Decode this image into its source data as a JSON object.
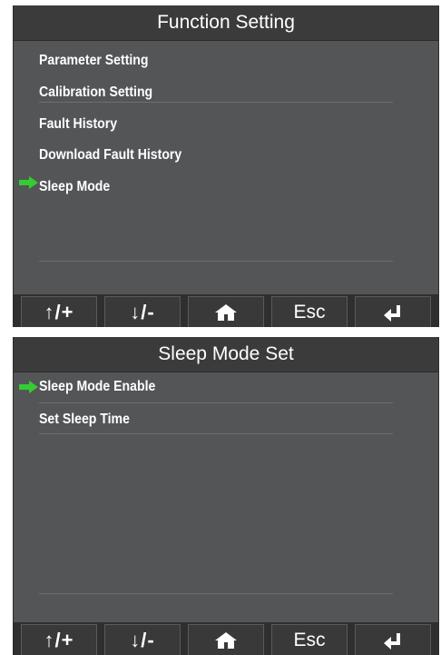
{
  "screen1": {
    "title": "Function Setting",
    "items": [
      {
        "label": "Parameter Setting"
      },
      {
        "label": "Calibration Setting"
      },
      {
        "label": "Fault History"
      },
      {
        "label": "Download Fault History"
      },
      {
        "label": "Sleep Mode"
      }
    ],
    "selected_index": 4
  },
  "screen2": {
    "title": "Sleep Mode Set",
    "items": [
      {
        "label": "Sleep Mode Enable"
      },
      {
        "label": "Set Sleep Time"
      }
    ],
    "selected_index": 0
  },
  "buttons": {
    "up_plus": "↑/+",
    "down_minus": "↓/-",
    "home": "home",
    "esc": "Esc",
    "enter": "enter"
  },
  "colors": {
    "background": "#545556",
    "titlebar": "#3b3b3b",
    "selector_arrow": "#33cc33",
    "text": "#ffffff"
  },
  "icons": {
    "selector": "green-right-arrow-icon",
    "home": "home-icon",
    "enter": "enter-return-icon"
  }
}
